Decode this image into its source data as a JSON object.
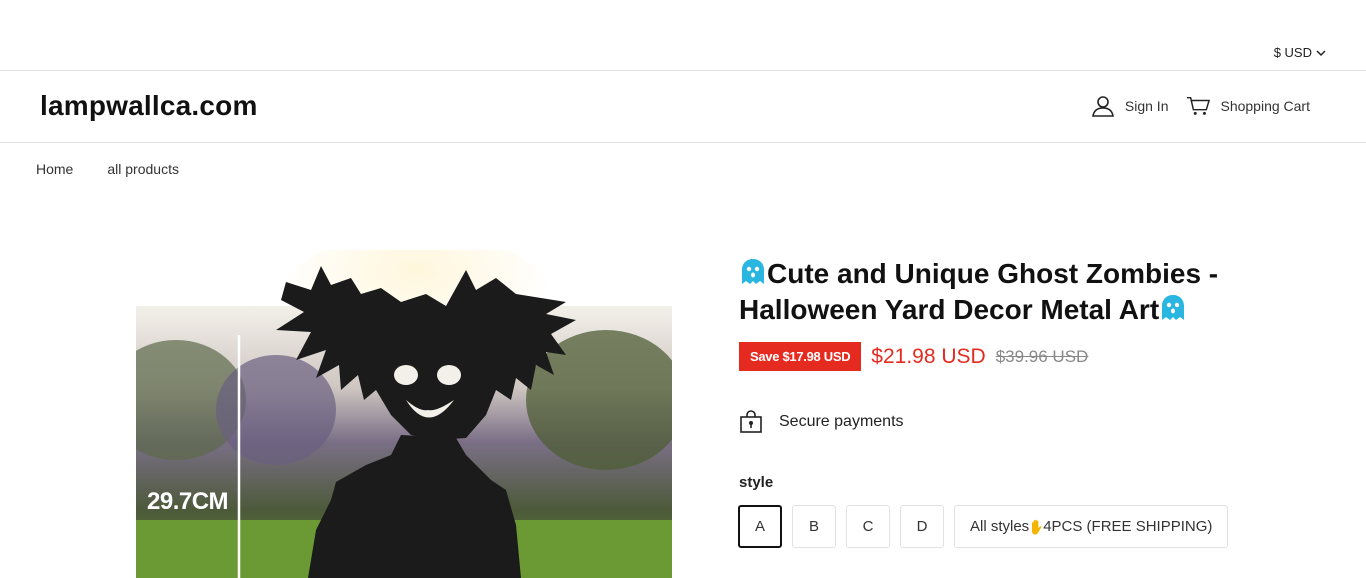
{
  "topbar": {
    "currency": "$ USD"
  },
  "header": {
    "logo": "lampwallca.com",
    "sign_in": "Sign In",
    "cart": "Shopping Cart"
  },
  "breadcrumb": [
    "Home",
    "all products"
  ],
  "product": {
    "image_label": "29.7CM",
    "title_line1": "Cute and Unique Ghost Zombies -",
    "title_line2": "Halloween Yard Decor Metal Art",
    "save_badge": "Save $17.98 USD",
    "price": "$21.98 USD",
    "compare_price": "$39.96 USD",
    "secure_payments": "Secure payments",
    "style_label": "style",
    "options": [
      "A",
      "B",
      "C",
      "D",
      "All styles",
      "4PCS (FREE SHIPPING)"
    ],
    "selected_option": "A"
  },
  "colors": {
    "accent_red": "#e52b20",
    "ghost_icon": "#29b6e0",
    "border": "#e2e2e2"
  },
  "icons": [
    "chevron-down-icon",
    "user-icon",
    "cart-icon",
    "ghost-icon",
    "lock-bag-icon",
    "hand-icon"
  ]
}
